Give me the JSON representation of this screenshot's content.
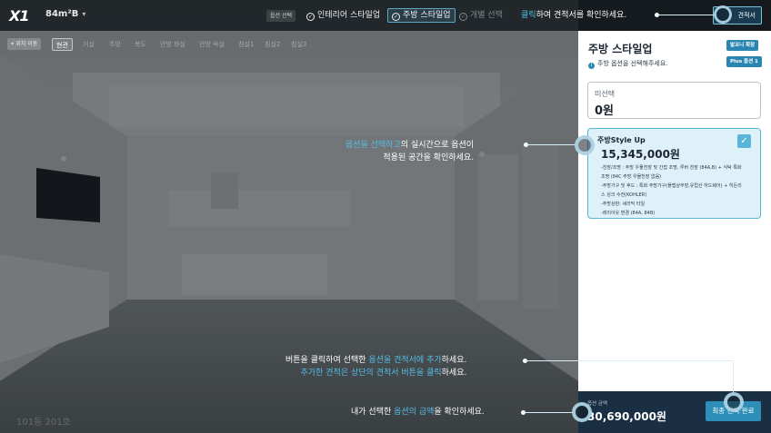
{
  "topbar": {
    "logo": "X1",
    "unit": "84m²B",
    "step_badge": "옵션 선택",
    "steps": [
      {
        "label": "인테리어 스타일업",
        "state": "done",
        "icon": "check-circle-icon"
      },
      {
        "label": "주방 스타일업",
        "state": "current",
        "icon": "check-circle-icon"
      },
      {
        "label": "개별 선택",
        "state": "disabled",
        "icon": "check-circle-icon"
      }
    ],
    "quote_button": "견적서"
  },
  "rooms": {
    "location_button": "위치 이동",
    "tabs": [
      "현관",
      "거실",
      "주방",
      "복도",
      "안방 화실",
      "안방 욕실",
      "침실1",
      "침실2",
      "침실3"
    ],
    "active_index": 0
  },
  "scene": {
    "unit_label": "101동 201호"
  },
  "panel": {
    "title": "주방 스타일업",
    "subtitle": "주방 옵션을 선택해주세요.",
    "tags": [
      "발코니 확장",
      "Plus 옵션 1"
    ],
    "none_option": {
      "label": "미선택",
      "price": "0원"
    },
    "upgrade_option": {
      "name": "주방Style Up",
      "price": "15,345,000원",
      "checked": true,
      "details": [
        "-천장/조명 : 주방 우물천장 및 간접 조명, 루버 천장 (84A,B) + 식탁 특화",
        "조명 (84C 주방 우물천장 없음)",
        "-주방가구 및 후드 : 특화 주방가구(플랩상부장,유럽산 하드웨어) + 히든리",
        "스 싱크 수전(KOHLER)",
        "-주방상판: 세라믹 타일",
        "-레이아웃 변경 (84A, 84B)"
      ]
    }
  },
  "bottom": {
    "total_label": "옵션 금액",
    "total": "30,690,000원",
    "final_button": "최종 견적 완료"
  },
  "guides": {
    "quote": {
      "hl": "클릭",
      "rest": "하여 견적서를 확인하세요."
    },
    "select": {
      "hl": "옵션을 선택하고",
      "rest1": "의 실시간으로 옵션이",
      "line2": "적용된 공간을 확인하세요."
    },
    "add": {
      "p1": "버튼을 클릭하여 선택한 ",
      "hl1": "옵션을 견적서에 추가",
      "p2": "하세요.",
      "hl2": "추가한 견적은 상단의 견적서 버튼을 클릭",
      "p3": "하세요."
    },
    "amount": {
      "p1": "내가 선택한 ",
      "hl": "옵션의 금액",
      "p2": "을 확인하세요."
    }
  },
  "colors": {
    "accent": "#53bde4",
    "panel_bg": "#ffffff",
    "bottom_bg": "#1a2f43",
    "selected_card": "#def1f9"
  }
}
